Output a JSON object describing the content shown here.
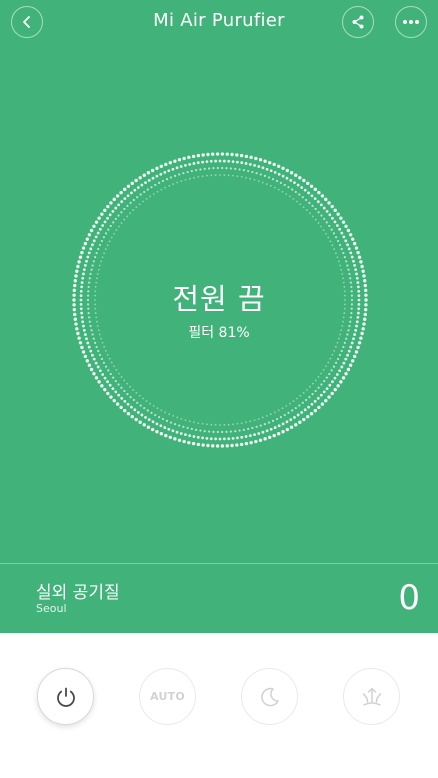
{
  "header": {
    "title": "Mi Air Purufier",
    "icons": {
      "back": "chevron-left-icon",
      "share": "share-icon",
      "more": "more-dots-icon"
    }
  },
  "status": {
    "power_text": "전원 끔",
    "filter_text": "필터 81%"
  },
  "outdoor": {
    "label": "실외 공기질",
    "city": "Seoul",
    "value": "0"
  },
  "controls": {
    "auto_label": "AUTO",
    "icons": [
      "power-icon",
      "auto-icon",
      "moon-icon",
      "fan-icon"
    ]
  },
  "colors": {
    "primary_green": "#41b27a",
    "inactive_gray": "#d2d2d2",
    "power_icon": "#4a4a4a"
  }
}
